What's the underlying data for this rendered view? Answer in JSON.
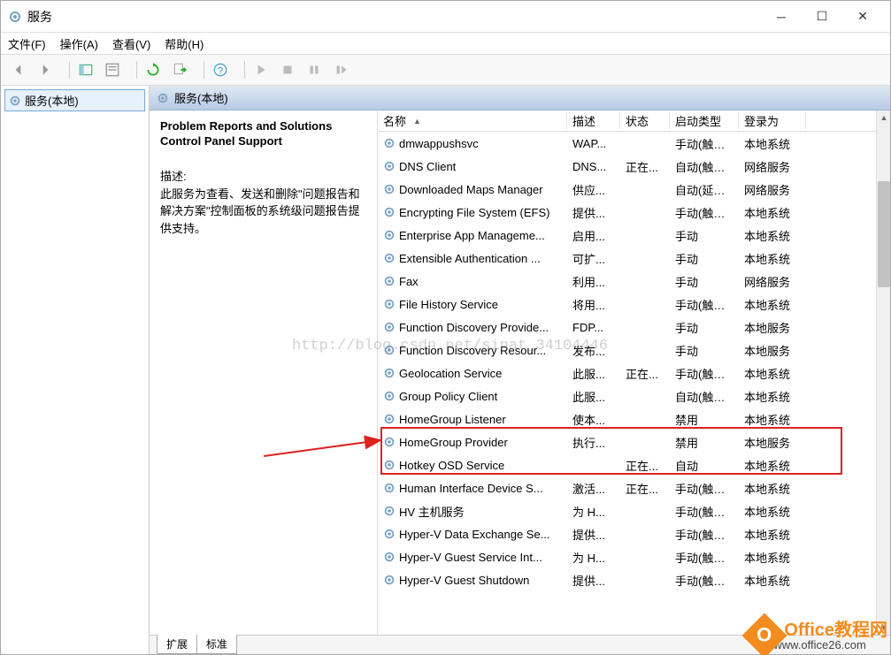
{
  "window": {
    "title": "服务"
  },
  "menubar": {
    "file": "文件(F)",
    "action": "操作(A)",
    "view": "查看(V)",
    "help": "帮助(H)"
  },
  "tree": {
    "root": "服务(本地)"
  },
  "content_header": "服务(本地)",
  "detail": {
    "selected_name": "Problem Reports and Solutions Control Panel Support",
    "desc_label": "描述:",
    "desc_text": "此服务为查看、发送和删除\"问题报告和解决方案\"控制面板的系统级问题报告提供支持。"
  },
  "columns": {
    "name": "名称",
    "desc": "描述",
    "status": "状态",
    "startup": "启动类型",
    "logon": "登录为"
  },
  "services": [
    {
      "name": "dmwappushsvc",
      "desc": "WAP...",
      "status": "",
      "startup": "手动(触发...",
      "logon": "本地系统"
    },
    {
      "name": "DNS Client",
      "desc": "DNS...",
      "status": "正在...",
      "startup": "自动(触发...",
      "logon": "网络服务"
    },
    {
      "name": "Downloaded Maps Manager",
      "desc": "供应...",
      "status": "",
      "startup": "自动(延迟...",
      "logon": "网络服务"
    },
    {
      "name": "Encrypting File System (EFS)",
      "desc": "提供...",
      "status": "",
      "startup": "手动(触发...",
      "logon": "本地系统"
    },
    {
      "name": "Enterprise App Manageme...",
      "desc": "启用...",
      "status": "",
      "startup": "手动",
      "logon": "本地系统"
    },
    {
      "name": "Extensible Authentication ...",
      "desc": "可扩...",
      "status": "",
      "startup": "手动",
      "logon": "本地系统"
    },
    {
      "name": "Fax",
      "desc": "利用...",
      "status": "",
      "startup": "手动",
      "logon": "网络服务"
    },
    {
      "name": "File History Service",
      "desc": "将用...",
      "status": "",
      "startup": "手动(触发...",
      "logon": "本地系统"
    },
    {
      "name": "Function Discovery Provide...",
      "desc": "FDP...",
      "status": "",
      "startup": "手动",
      "logon": "本地服务"
    },
    {
      "name": "Function Discovery Resour...",
      "desc": "发布...",
      "status": "",
      "startup": "手动",
      "logon": "本地服务"
    },
    {
      "name": "Geolocation Service",
      "desc": "此服...",
      "status": "正在...",
      "startup": "手动(触发...",
      "logon": "本地系统"
    },
    {
      "name": "Group Policy Client",
      "desc": "此服...",
      "status": "",
      "startup": "自动(触发...",
      "logon": "本地系统"
    },
    {
      "name": "HomeGroup Listener",
      "desc": "使本...",
      "status": "",
      "startup": "禁用",
      "logon": "本地系统"
    },
    {
      "name": "HomeGroup Provider",
      "desc": "执行...",
      "status": "",
      "startup": "禁用",
      "logon": "本地服务"
    },
    {
      "name": "Hotkey OSD Service",
      "desc": "",
      "status": "正在...",
      "startup": "自动",
      "logon": "本地系统"
    },
    {
      "name": "Human Interface Device S...",
      "desc": "激活...",
      "status": "正在...",
      "startup": "手动(触发...",
      "logon": "本地系统"
    },
    {
      "name": "HV 主机服务",
      "desc": "为 H...",
      "status": "",
      "startup": "手动(触发...",
      "logon": "本地系统"
    },
    {
      "name": "Hyper-V Data Exchange Se...",
      "desc": "提供...",
      "status": "",
      "startup": "手动(触发...",
      "logon": "本地系统"
    },
    {
      "name": "Hyper-V Guest Service Int...",
      "desc": "为 H...",
      "status": "",
      "startup": "手动(触发...",
      "logon": "本地系统"
    },
    {
      "name": "Hyper-V Guest Shutdown",
      "desc": "提供...",
      "status": "",
      "startup": "手动(触发...",
      "logon": "本地系统"
    }
  ],
  "tabs": {
    "extended": "扩展",
    "standard": "标准"
  },
  "watermark": "http://blog.csdn.net/sinat_34104446",
  "badge": {
    "brand_en": "Office",
    "brand_cn": "教程网",
    "url": "www.office26.com"
  }
}
